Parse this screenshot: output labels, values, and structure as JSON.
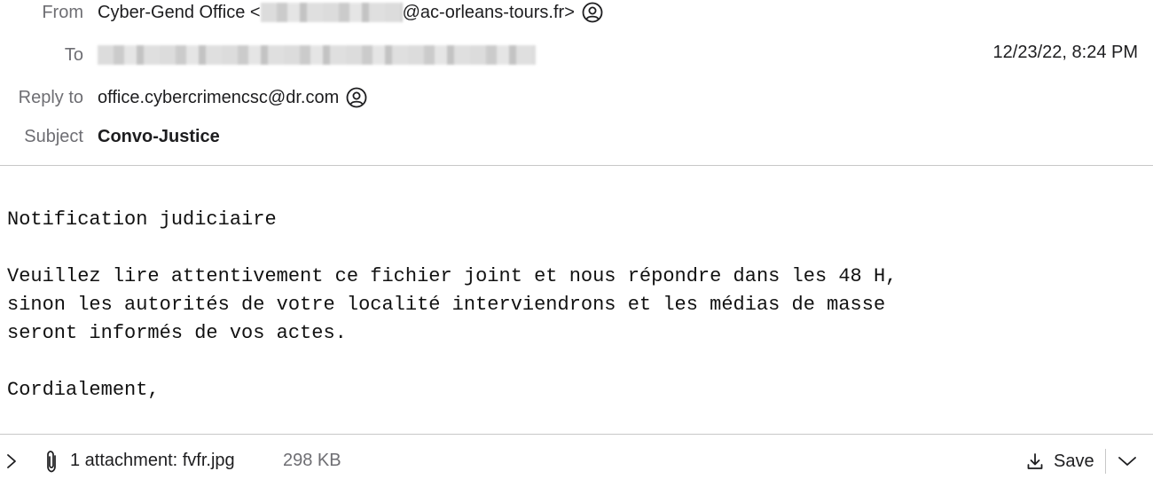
{
  "header": {
    "from_label": "From",
    "from_name": "Cyber-Gend Office <",
    "from_domain": "@ac-orleans-tours.fr>",
    "to_label": "To",
    "date": "12/23/22, 8:24 PM",
    "reply_label": "Reply to",
    "reply_value": "office.cybercrimencsc@dr.com",
    "subject_label": "Subject",
    "subject_value": "Convo-Justice"
  },
  "body": {
    "text": "Notification judiciaire\n\nVeuillez lire attentivement ce fichier joint et nous répondre dans les 48 H,\nsinon les autorités de votre localité interviendrons et les médias de masse\nseront informés de vos actes.\n\nCordialement,"
  },
  "attachment": {
    "label": "1 attachment: fvfr.jpg",
    "size": "298 KB",
    "save_label": "Save"
  },
  "icons": {
    "from_contact": "person-circle-icon",
    "reply_contact": "person-circle-icon",
    "expand": "chevron-right-icon",
    "paperclip": "paperclip-icon",
    "download": "download-icon",
    "save_menu": "chevron-down-icon"
  },
  "colors": {
    "label": "#6e6e73",
    "text": "#1d1d1f",
    "divider": "#c8c8c8"
  }
}
